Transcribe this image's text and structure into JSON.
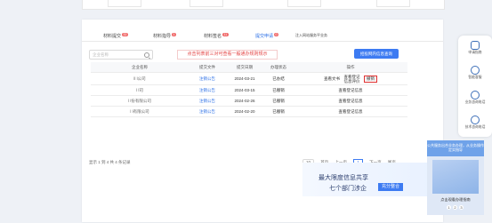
{
  "tabs": [
    {
      "label": "材料提交",
      "badge": "32"
    },
    {
      "label": "材料指导",
      "badge": "1"
    },
    {
      "label": "材料签名",
      "badge": "11"
    },
    {
      "label": "提交申请",
      "badge": "0"
    },
    {
      "label": "注入网站服务平业务",
      "badge": ""
    }
  ],
  "search": {
    "placeholder": "企业名称"
  },
  "hint": "点击列表前三对可查看一般通办规则规示",
  "action_button": "招投网内信息查询",
  "table": {
    "headers": [
      "企业名称",
      "提交文件",
      "提交日期",
      "办理状态",
      "操作"
    ],
    "rows": [
      {
        "name": "ll     l公司",
        "doc": "注销公告",
        "date": "2024-03-21",
        "status": "已办结",
        "op1": "查看文书",
        "op2": "查看登记信息评价",
        "op3": "撤销"
      },
      {
        "name": "l      l司",
        "doc": "注销公告",
        "date": "2024-03-15",
        "status": "已撤销",
        "op1": "",
        "op2": "查看登记信息",
        "op3": ""
      },
      {
        "name": "l      l份有限公司",
        "doc": "注销公告",
        "date": "2024-02-26",
        "status": "已撤销",
        "op1": "",
        "op2": "查看登记信息",
        "op3": ""
      },
      {
        "name": "l      l有限公司",
        "doc": "注销公告",
        "date": "2024-02-20",
        "status": "已撤销",
        "op1": "",
        "op2": "查看登记信息",
        "op3": ""
      }
    ]
  },
  "footer_summary": "显示 1 到 4 共 4 条记录",
  "pager": {
    "size": "10",
    "first": "首页",
    "prev": "上一页",
    "page": "1",
    "next": "下一页",
    "last": "尾页"
  },
  "ad": {
    "line1": "最大限度信息共享",
    "line2": "七个部门涉企",
    "button": "充分整合"
  },
  "sidebar": [
    {
      "label": "申请指南",
      "icon": "guide-icon"
    },
    {
      "label": "智能客服",
      "icon": "headset-icon"
    },
    {
      "label": "业务咨询电话",
      "icon": "phone-icon"
    },
    {
      "label": "技术咨询电话",
      "icon": "chat-icon"
    }
  ],
  "promo": {
    "title": "公共服务出合业务办理，从业务操作定实指导",
    "caption": "点击观看办理指南",
    "dots": [
      "1",
      "2",
      "3"
    ]
  }
}
